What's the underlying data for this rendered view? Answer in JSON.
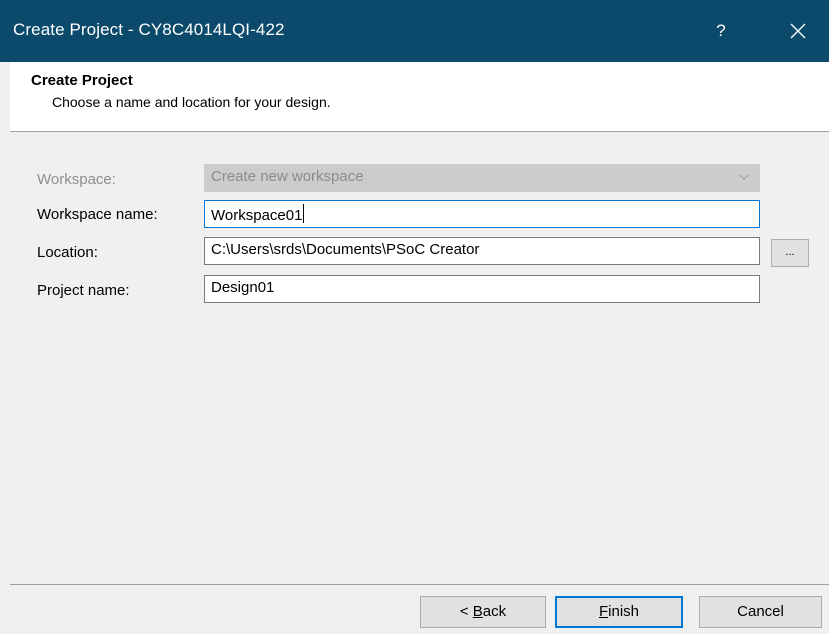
{
  "window": {
    "title": "Create Project - CY8C4014LQI-422",
    "help_label": "?",
    "close_icon": "close-icon"
  },
  "header": {
    "title": "Create Project",
    "subtitle": "Choose a name and location for your design."
  },
  "form": {
    "workspace": {
      "label": "Workspace:",
      "value": "Create new workspace",
      "enabled": false
    },
    "workspace_name": {
      "label": "Workspace name:",
      "value": "Workspace01"
    },
    "location": {
      "label": "Location:",
      "value": "C:\\Users\\srds\\Documents\\PSoC Creator",
      "browse_label": "..."
    },
    "project_name": {
      "label": "Project name:",
      "value": "Design01"
    }
  },
  "footer": {
    "back": {
      "prefix": "< ",
      "mnemonic": "B",
      "rest": "ack"
    },
    "finish": {
      "mnemonic": "F",
      "rest": "inish"
    },
    "cancel_label": "Cancel"
  },
  "colors": {
    "titlebar": "#0c4a6b",
    "focus_border": "#0078d7",
    "dialog_background": "#f0f0f0",
    "disabled_text": "#8e8e8e"
  }
}
